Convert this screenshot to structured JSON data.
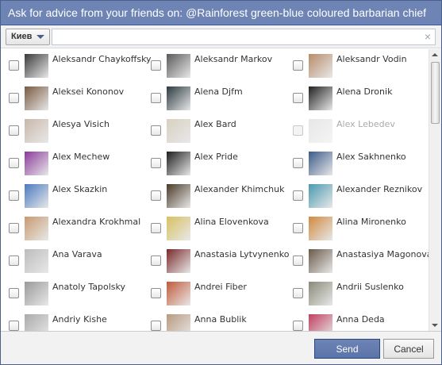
{
  "title": "Ask for advice from your friends on: @Rainforest green-blue coloured barbarian chief",
  "filter": {
    "dropdown_label": "Киев",
    "search_value": "",
    "clear_icon": "×"
  },
  "friends": [
    [
      {
        "name": "Aleksandr Chaykoffsky",
        "avatar": "#3a3a3a",
        "checked": false,
        "disabled": false
      },
      {
        "name": "Aleksandr Markov",
        "avatar": "#5a5a5a",
        "checked": false,
        "disabled": false
      },
      {
        "name": "Aleksandr Vodin",
        "avatar": "#b78c6a",
        "checked": false,
        "disabled": false
      }
    ],
    [
      {
        "name": "Aleksei Kononov",
        "avatar": "#7a5a40",
        "checked": false,
        "disabled": false
      },
      {
        "name": "Alena Djfm",
        "avatar": "#2b3a3f",
        "checked": false,
        "disabled": false
      },
      {
        "name": "Alena Dronik",
        "avatar": "#222222",
        "checked": false,
        "disabled": false
      }
    ],
    [
      {
        "name": "Alesya Visich",
        "avatar": "#c9b8aa",
        "checked": false,
        "disabled": false
      },
      {
        "name": "Alex Bard",
        "avatar": "#d8d0c0",
        "checked": false,
        "disabled": false
      },
      {
        "name": "Alex Lebedev",
        "avatar": "#c8c8c8",
        "checked": false,
        "disabled": true
      }
    ],
    [
      {
        "name": "Alex Mechew",
        "avatar": "#8a3a9a",
        "checked": false,
        "disabled": false
      },
      {
        "name": "Alex Pride",
        "avatar": "#1e1e1e",
        "checked": false,
        "disabled": false
      },
      {
        "name": "Alex Sakhnenko",
        "avatar": "#3b5a8a",
        "checked": false,
        "disabled": false
      }
    ],
    [
      {
        "name": "Alex Skazkin",
        "avatar": "#4a7ac0",
        "checked": false,
        "disabled": false
      },
      {
        "name": "Alexander Khimchuk",
        "avatar": "#4a3a2a",
        "checked": false,
        "disabled": false
      },
      {
        "name": "Alexander Reznikov",
        "avatar": "#4a9ab0",
        "checked": false,
        "disabled": false
      }
    ],
    [
      {
        "name": "Alexandra Krokhmal",
        "avatar": "#c89a70",
        "checked": false,
        "disabled": false
      },
      {
        "name": "Alina Elovenkova",
        "avatar": "#d8c060",
        "checked": false,
        "disabled": false
      },
      {
        "name": "Alina Mironenko",
        "avatar": "#d08a40",
        "checked": false,
        "disabled": false
      }
    ],
    [
      {
        "name": "Ana Varava",
        "avatar": "#bcbcbc",
        "checked": false,
        "disabled": false
      },
      {
        "name": "Anastasia Lytvynenko",
        "avatar": "#7a2a2a",
        "checked": false,
        "disabled": false
      },
      {
        "name": "Anastasiya Magonova",
        "avatar": "#6a5a4a",
        "checked": false,
        "disabled": false
      }
    ],
    [
      {
        "name": "Anatoly Tapolsky",
        "avatar": "#9a9a9a",
        "checked": false,
        "disabled": false
      },
      {
        "name": "Andrei Fiber",
        "avatar": "#c05a3a",
        "checked": false,
        "disabled": false
      },
      {
        "name": "Andrii Suslenko",
        "avatar": "#8a8a7a",
        "checked": false,
        "disabled": false
      }
    ],
    [
      {
        "name": "Andriy Kishe",
        "avatar": "#aaaaaa",
        "checked": false,
        "disabled": false
      },
      {
        "name": "Anna Bublik",
        "avatar": "#b89a80",
        "checked": false,
        "disabled": false
      },
      {
        "name": "Anna Deda",
        "avatar": "#c04060",
        "checked": false,
        "disabled": false
      }
    ]
  ],
  "footer": {
    "send_label": "Send",
    "cancel_label": "Cancel"
  },
  "colors": {
    "titlebar": "#6d84b4",
    "send_button": "#5b74a8"
  }
}
